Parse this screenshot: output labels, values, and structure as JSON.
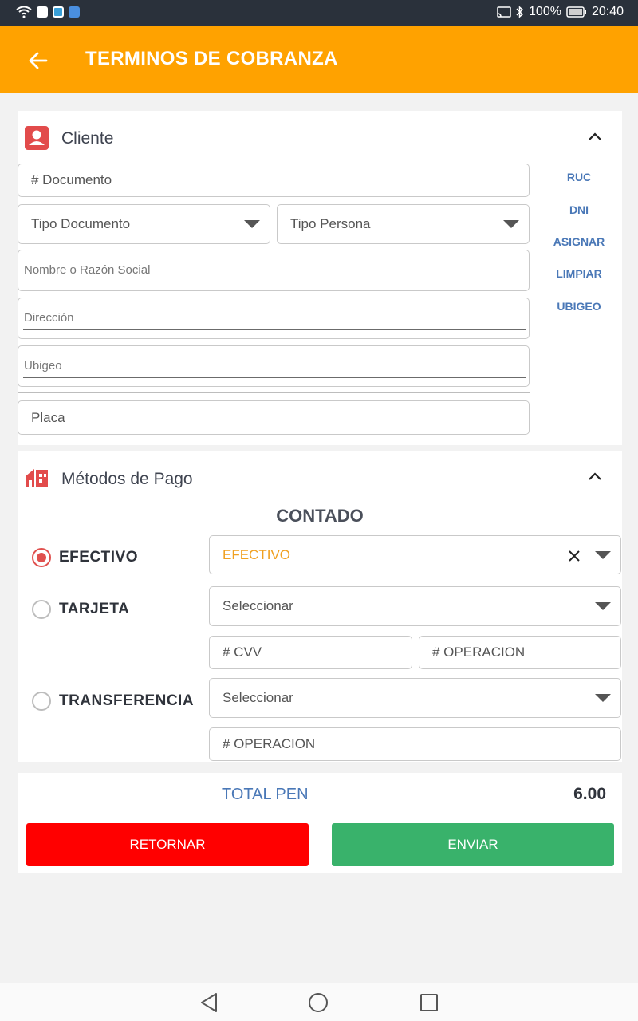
{
  "status_bar": {
    "battery": "100%",
    "time": "20:40"
  },
  "app_bar": {
    "title": "TERMINOS DE COBRANZA"
  },
  "cliente": {
    "title": "Cliente",
    "documento_placeholder": "# Documento",
    "tipo_documento": "Tipo Documento",
    "tipo_persona": "Tipo Persona",
    "nombre_label": "Nombre o Razón Social",
    "direccion_label": "Dirección",
    "ubigeo_label": "Ubigeo",
    "placa_placeholder": "Placa",
    "side_links": [
      "RUC",
      "DNI",
      "ASIGNAR",
      "LIMPIAR",
      "UBIGEO"
    ]
  },
  "metodos": {
    "title": "Métodos de Pago",
    "subtitle": "CONTADO",
    "efectivo_label": "EFECTIVO",
    "efectivo_value": "EFECTIVO",
    "tarjeta_label": "TARJETA",
    "tarjeta_select": "Seleccionar",
    "cvv_placeholder": "# CVV",
    "operacion_placeholder": "# OPERACION",
    "transferencia_label": "TRANSFERENCIA",
    "transferencia_select": "Seleccionar",
    "transferencia_operacion": "# OPERACION"
  },
  "total": {
    "label": "TOTAL PEN",
    "value": "6.00"
  },
  "buttons": {
    "retornar": "RETORNAR",
    "enviar": "ENVIAR"
  },
  "colors": {
    "accent": "#ffa200",
    "link": "#4a78b7",
    "danger": "#ff0000",
    "success": "#39b26b",
    "radio_on": "#e0504e"
  }
}
